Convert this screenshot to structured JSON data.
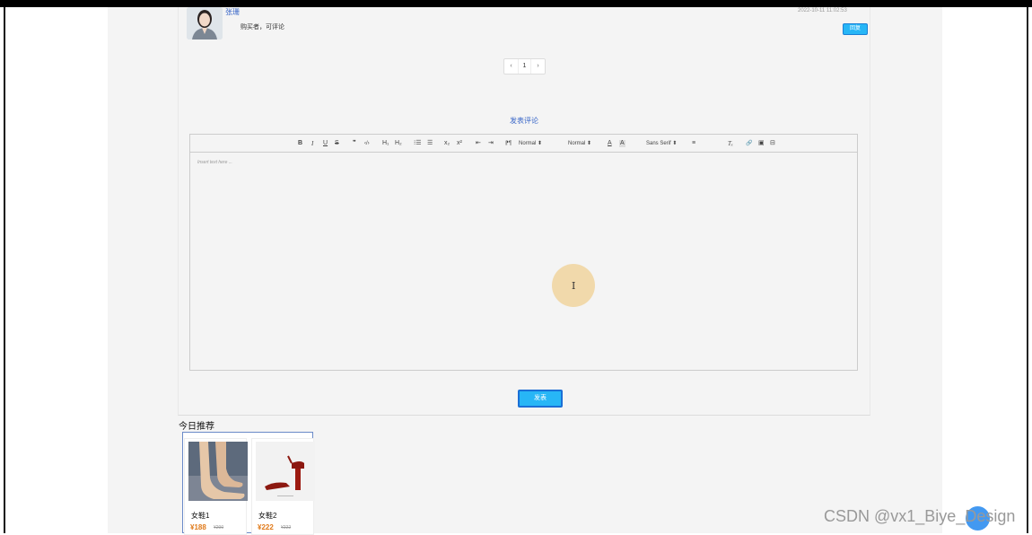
{
  "comment": {
    "username": "张珊",
    "text": "购买者，可评论",
    "timestamp": "2022-10-11 11:02:53",
    "reply_label": "回复"
  },
  "pager": {
    "prev": "‹",
    "current": "1",
    "next": "›"
  },
  "post": {
    "title": "发表评论",
    "placeholder": "Insert text here ...",
    "submit_label": "发表"
  },
  "toolbar": {
    "bold": "B",
    "italic": "I",
    "underline": "U",
    "strike": "S",
    "quote": "❞",
    "code": "‹/›",
    "h1": "H₁",
    "h2": "H₂",
    "ordered_list": "⁝☰",
    "bullet_list": "☰",
    "subscript": "x₂",
    "superscript": "x²",
    "indent_dec": "⇤",
    "indent_inc": "⇥",
    "direction": "⁋¶",
    "size_select": "Normal ⬍",
    "header_select": "Normal ⬍",
    "color": "A",
    "background": "A",
    "font_select": "Sans Serif ⬍",
    "align": "≡",
    "clean": "Tₓ",
    "link": "🔗",
    "image": "▣",
    "video": "⊟"
  },
  "recommend": {
    "title": "今日推荐",
    "items": [
      {
        "name": "女鞋1",
        "price": "¥188",
        "old_price": "¥200"
      },
      {
        "name": "女鞋2",
        "price": "¥222",
        "old_price": "¥222"
      }
    ]
  },
  "watermark": "CSDN @vx1_Biye_Design",
  "colors": {
    "accent": "#27b6f6",
    "link": "#3a67c8",
    "price": "#e07a1a"
  }
}
